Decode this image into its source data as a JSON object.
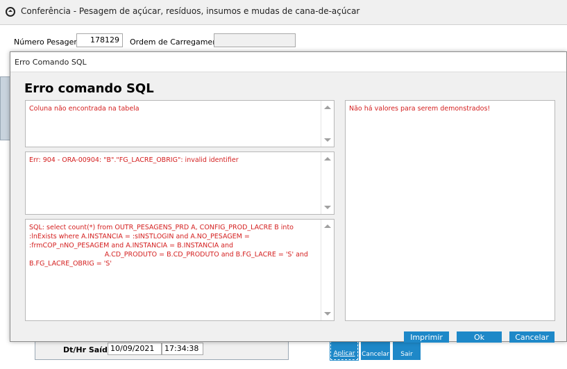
{
  "window": {
    "title": "Conferência - Pesagem de açúcar, resíduos, insumos e mudas de cana-de-açúcar"
  },
  "form": {
    "numero_pesagem_label": "Número Pesagem:",
    "numero_pesagem_value": "178129",
    "ordem_carregamento_label": "Ordem de Carregamento:",
    "ordem_carregamento_value": "",
    "dt_hr_saida_label": "Dt/Hr Saída:",
    "dt_saida_value": "10/09/2021",
    "hr_saida_value": "17:34:38"
  },
  "toolbar": {
    "aplicar": "Aplicar",
    "cancelar": "Cancelar",
    "sair": "Sair"
  },
  "dialog": {
    "title": "Erro Comando SQL",
    "heading": "Erro comando SQL",
    "message": "Coluna não encontrada na tabela",
    "error": "Err: 904 - ORA-00904: \"B\".\"FG_LACRE_OBRIG\": invalid identifier",
    "sql": "SQL: select count(*) from OUTR_PESAGENS_PRD A, CONFIG_PROD_LACRE B into :lnExists where A.INSTANCIA = :sINSTLOGIN and A.NO_PESAGEM = :frmCOP_nNO_PESAGEM and A.INSTANCIA = B.INSTANCIA and\n                                    A.CD_PRODUTO = B.CD_PRODUTO and B.FG_LACRE = 'S' and B.FG_LACRE_OBRIG = 'S'",
    "values": "Não há valores para serem demonstrados!",
    "buttons": {
      "imprimir": "Imprimir",
      "ok": "Ok",
      "cancelar": "Cancelar"
    }
  },
  "colors": {
    "accent": "#1e88c8",
    "error_text": "#d42020"
  }
}
